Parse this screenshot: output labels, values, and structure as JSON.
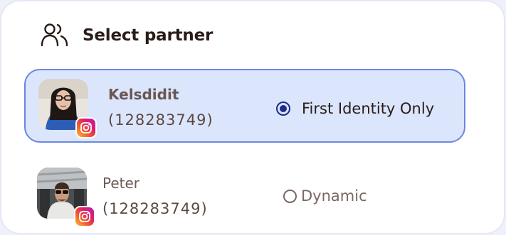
{
  "header": {
    "title": "Select partner",
    "icon": "users-icon"
  },
  "partners": [
    {
      "name": "Kelsdidit",
      "id": "(128283749)",
      "platform": "instagram",
      "option_label": "First Identity Only",
      "selected": true
    },
    {
      "name": "Peter",
      "id": "(128283749)",
      "platform": "instagram",
      "option_label": "Dynamic",
      "selected": false
    }
  ],
  "colors": {
    "accent": "#1d2d8a",
    "selected_bg": "#dbe6fd",
    "selected_border": "#6a86e0",
    "text_dark": "#2a1c17"
  }
}
